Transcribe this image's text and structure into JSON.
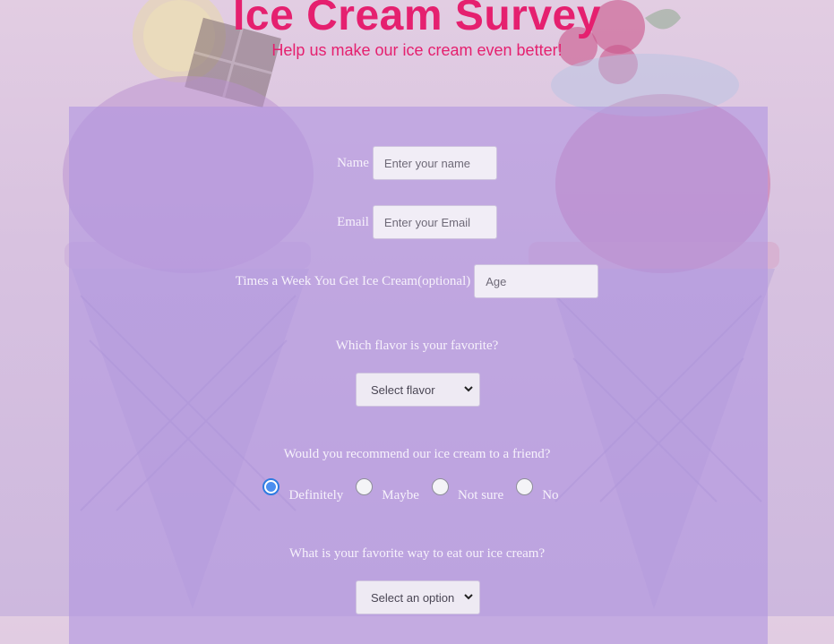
{
  "header": {
    "title": "Ice Cream Survey",
    "subtitle": "Help us make our ice cream even better!"
  },
  "form": {
    "name": {
      "label": "Name",
      "placeholder": "Enter your name",
      "value": ""
    },
    "email": {
      "label": "Email",
      "placeholder": "Enter your Email",
      "value": ""
    },
    "times": {
      "label": "Times a Week You Get Ice Cream(optional)",
      "placeholder": "Age",
      "value": ""
    },
    "flavor": {
      "question": "Which flavor is your favorite?",
      "selected": "Select flavor"
    },
    "recommend": {
      "question": "Would you recommend our ice cream to a friend?",
      "options": [
        "Definitely",
        "Maybe",
        "Not sure",
        "No"
      ],
      "checked": "Definitely"
    },
    "way": {
      "question": "What is your favorite way to eat our ice cream?",
      "selected": "Select an option"
    }
  },
  "colors": {
    "accent": "#e5206f",
    "panel": "#b296e0",
    "radio_checked": "#2f7be0"
  }
}
